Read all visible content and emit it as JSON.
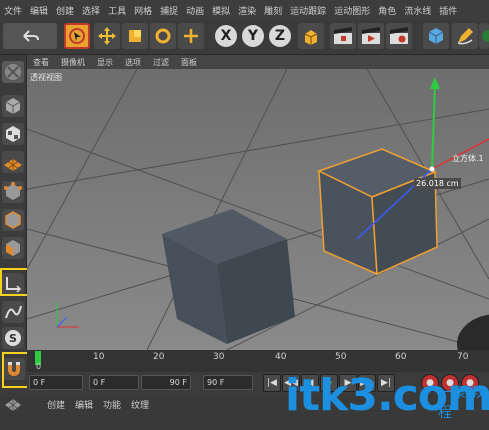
{
  "menubar": {
    "items": [
      "文件",
      "编辑",
      "创建",
      "选择",
      "工具",
      "网格",
      "捕捉",
      "动画",
      "模拟",
      "渲染",
      "雕刻",
      "运动跟踪",
      "运动图形",
      "角色",
      "流水线",
      "插件"
    ]
  },
  "toolbar": {
    "undo_icon": "undo-icon",
    "axis_x": "X",
    "axis_y": "Y",
    "axis_z": "Z"
  },
  "viewport": {
    "menu": [
      "查看",
      "摄像机",
      "显示",
      "选项",
      "过滤",
      "面板"
    ],
    "label": "透视视图",
    "object_label": "立方体.1",
    "dimension_label": "26.018 cm"
  },
  "timeline": {
    "ticks": [
      "10",
      "20",
      "30",
      "40",
      "50",
      "60",
      "70"
    ],
    "start_frame": "0"
  },
  "transport": {
    "frame_start": "0 F",
    "frame_range_start": "0 F",
    "frame_range_end": "90 F",
    "frame_end": "90 F"
  },
  "bottom": {
    "menu": [
      "创建",
      "编辑",
      "功能",
      "纹理"
    ]
  },
  "watermark": {
    "text": "itk3.com",
    "cn": "一聚 教程"
  },
  "colors": {
    "selection_orange": "#f0a030",
    "highlight_yellow": "#f3d11c",
    "axis_green": "#2ecc40",
    "axis_blue": "#3a5cff",
    "axis_red": "#e03030"
  }
}
